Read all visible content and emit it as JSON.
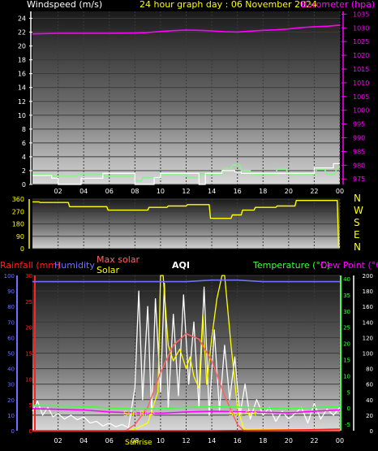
{
  "title": "24 hour graph day : 06 November 2024",
  "colors": {
    "background": "#000000",
    "wind": "#90ee90",
    "gust": "#ffffff",
    "baro": "#ff00ff",
    "dir": "#ffff00",
    "rain": "#ff2020",
    "humidity": "#7070ff",
    "max_solar": "#ff6464",
    "solar": "#ffff00",
    "aqi": "#ffffff",
    "temp": "#40ff40",
    "dew": "#ff00ff",
    "dir_letters": "#ffff00",
    "axis_white": "#ffffff"
  },
  "chart_data": [
    {
      "type": "line",
      "panel": "wind-baro",
      "left_axis_label": "Windspeed (m/s)",
      "right_axis_label": "Barometer (hpa)",
      "x_ticks": [
        "02",
        "04",
        "06",
        "08",
        "10",
        "12",
        "14",
        "16",
        "18",
        "20",
        "22",
        "00"
      ],
      "left_ticks": [
        0,
        2,
        4,
        6,
        8,
        10,
        12,
        14,
        16,
        18,
        20,
        22,
        24
      ],
      "left_range": [
        0,
        25
      ],
      "right_ticks": [
        975,
        980,
        985,
        990,
        995,
        1000,
        1005,
        1010,
        1015,
        1020,
        1025,
        1030,
        1035
      ],
      "right_range": [
        973,
        1036
      ],
      "x_range": [
        0,
        24
      ],
      "series": [
        {
          "name": "Windspeed (m/s)",
          "role": "wind",
          "x": [
            0,
            1.5,
            1.6,
            3.5,
            3.6,
            5.5,
            5.6,
            8.0,
            8.1,
            8.5,
            8.6,
            10.0,
            10.1,
            12.0,
            12.1,
            13.0,
            13.1,
            14.8,
            14.9,
            15.5,
            15.6,
            16.2,
            16.3,
            17.0,
            17.1,
            19.0,
            19.1,
            19.8,
            20.0,
            22.0,
            22.2,
            22.8,
            23.0,
            23.6,
            23.8,
            24
          ],
          "y": [
            1.5,
            1.5,
            1.2,
            1.2,
            1.5,
            1.5,
            1.2,
            1.2,
            0.5,
            0.5,
            1.0,
            1.0,
            1.5,
            1.5,
            1.0,
            1.0,
            1.5,
            1.5,
            2.3,
            2.3,
            2.8,
            2.8,
            2.0,
            2.0,
            1.5,
            1.5,
            2.2,
            2.2,
            1.5,
            1.5,
            2.2,
            2.2,
            1.5,
            1.5,
            2.5,
            2.5
          ]
        },
        {
          "name": "Gust",
          "role": "gust",
          "x": [
            0,
            1.5,
            1.5,
            2.0,
            2.0,
            3.8,
            3.8,
            5.5,
            5.5,
            8.0,
            8.0,
            9.5,
            9.5,
            10.0,
            10.0,
            13.0,
            13.0,
            13.5,
            13.5,
            14.8,
            14.8,
            15.8,
            15.8,
            16.3,
            16.3,
            22.0,
            22.0,
            23.5,
            23.5,
            24
          ],
          "y": [
            1.3,
            1.3,
            0.9,
            0.9,
            0.0,
            0.0,
            0.9,
            0.9,
            1.6,
            1.6,
            0.0,
            0.0,
            1.0,
            1.0,
            1.6,
            1.6,
            0.0,
            0.0,
            1.6,
            1.6,
            2.0,
            2.0,
            1.8,
            1.8,
            1.6,
            1.6,
            2.4,
            2.4,
            3.0,
            3.0
          ]
        },
        {
          "name": "Barometer (hpa)",
          "role": "baro",
          "x": [
            0,
            2,
            4,
            6,
            8,
            9,
            10,
            11,
            12,
            13,
            14,
            15,
            16,
            17,
            18,
            19,
            20,
            21,
            22,
            23,
            24
          ],
          "y": [
            1027.8,
            1028.0,
            1028.0,
            1028.0,
            1028.1,
            1028.3,
            1028.7,
            1029.0,
            1029.2,
            1029.1,
            1028.9,
            1028.6,
            1028.5,
            1028.8,
            1029.1,
            1029.3,
            1029.6,
            1030.1,
            1030.4,
            1030.6,
            1031.0
          ]
        }
      ]
    },
    {
      "type": "line",
      "panel": "wind-direction",
      "left_ticks": [
        0,
        90,
        180,
        270,
        360
      ],
      "left_range": [
        0,
        360
      ],
      "direction_letters": [
        "N",
        "W",
        "S",
        "E",
        "N"
      ],
      "x_range": [
        0,
        24
      ],
      "series": [
        {
          "name": "Wind direction",
          "role": "dir",
          "x": [
            0,
            0.5,
            0.6,
            2.8,
            2.9,
            5.8,
            5.9,
            9.0,
            9.1,
            10.5,
            10.6,
            12.0,
            12.1,
            13.8,
            13.9,
            15.5,
            15.6,
            16.3,
            16.4,
            17.3,
            17.4,
            19.0,
            19.1,
            20.5,
            20.6,
            23.8,
            23.9,
            24
          ],
          "y": [
            340,
            340,
            335,
            335,
            305,
            305,
            280,
            280,
            300,
            300,
            310,
            310,
            320,
            320,
            220,
            220,
            245,
            245,
            280,
            280,
            300,
            300,
            310,
            310,
            350,
            350,
            20,
            10
          ]
        }
      ]
    },
    {
      "type": "line",
      "panel": "rain-humidity-solar-temp",
      "header_labels": [
        "Rainfall (mm)",
        "Humidity",
        "Max solar",
        "Solar",
        "AQI",
        "Temperature (°C)",
        "Dew Point (°C)"
      ],
      "annotations": [
        "Sun Rise",
        "Sun Set",
        "Sunrise"
      ],
      "x_ticks": [
        "02",
        "04",
        "06",
        "08",
        "10",
        "12",
        "14",
        "16",
        "18",
        "20",
        "22",
        "00"
      ],
      "humidity_ticks": [
        0,
        10,
        20,
        30,
        40,
        50,
        60,
        70,
        80,
        90,
        100
      ],
      "humidity_range": [
        0,
        100
      ],
      "rain_ticks": [
        0,
        5,
        10,
        15,
        20,
        25,
        30
      ],
      "rain_range": [
        0,
        30
      ],
      "temp_ticks": [
        -5,
        0,
        5,
        10,
        15,
        20,
        25,
        30,
        35,
        40
      ],
      "temp_range": [
        -7,
        41
      ],
      "solar_ticks": [
        0,
        20,
        40,
        60,
        80,
        100,
        120,
        140,
        160,
        180,
        200
      ],
      "solar_range": [
        0,
        200
      ],
      "x_range": [
        0,
        24
      ],
      "series": [
        {
          "name": "Humidity",
          "role": "humidity",
          "x": [
            0,
            4,
            8,
            12,
            14,
            16,
            18,
            20,
            22,
            24
          ],
          "y": [
            96,
            96,
            96,
            96,
            97,
            97,
            96,
            96,
            96,
            96
          ]
        },
        {
          "name": "Temperature (°C)",
          "role": "temp",
          "x": [
            0,
            2,
            4,
            6,
            8,
            10,
            12,
            14,
            16,
            18,
            20,
            22,
            24
          ],
          "y": [
            0.8,
            0.7,
            0.5,
            0.0,
            -0.3,
            -0.2,
            0.2,
            0.5,
            0.3,
            0.0,
            -0.2,
            0.2,
            0.5
          ]
        },
        {
          "name": "Dew Point (°C)",
          "role": "dew",
          "x": [
            0,
            2,
            4,
            6,
            8,
            10,
            12,
            14,
            16,
            18,
            20,
            22,
            24
          ],
          "y": [
            -0.2,
            -0.4,
            -0.6,
            -1.2,
            -1.5,
            -1.6,
            -1.2,
            -1.0,
            -1.1,
            -1.3,
            -1.5,
            -1.0,
            -0.6
          ]
        },
        {
          "name": "Rainfall (mm)",
          "role": "rain",
          "x": [
            0,
            14,
            18,
            22,
            24
          ],
          "y": [
            0,
            0,
            0.1,
            0.2,
            0.3
          ]
        },
        {
          "name": "Max solar",
          "role": "max_solar",
          "x": [
            0,
            7.3,
            8,
            9,
            10,
            11,
            12,
            13,
            14,
            15,
            16,
            16.5,
            24
          ],
          "y": [
            0,
            0,
            8,
            30,
            75,
            110,
            125,
            118,
            90,
            45,
            8,
            0,
            0
          ]
        },
        {
          "name": "Solar",
          "role": "solar",
          "x": [
            0,
            7.5,
            8,
            9,
            9.8,
            10.0,
            10.2,
            10.6,
            11,
            11.5,
            12,
            12.3,
            12.6,
            13,
            13.3,
            13.6,
            14,
            14.4,
            14.8,
            15.0,
            15.2,
            15.5,
            16,
            16.5,
            24
          ],
          "y": [
            0,
            0,
            2,
            10,
            50,
            200,
            200,
            110,
            90,
            105,
            80,
            95,
            70,
            55,
            150,
            60,
            120,
            170,
            200,
            200,
            165,
            110,
            30,
            2,
            2
          ]
        },
        {
          "name": "AQI",
          "role": "aqi",
          "x": [
            0,
            0.4,
            0.8,
            1.2,
            1.6,
            2,
            2.5,
            3,
            3.5,
            4,
            4.5,
            5,
            5.5,
            6,
            6.5,
            7,
            7.5,
            8,
            8.3,
            8.6,
            9,
            9.3,
            9.6,
            10,
            10.3,
            10.6,
            11,
            11.4,
            11.8,
            12.2,
            12.6,
            13,
            13.4,
            13.8,
            14.2,
            14.6,
            15,
            15.4,
            15.8,
            16.2,
            16.6,
            17,
            17.5,
            18,
            18.5,
            19,
            19.5,
            20,
            20.5,
            21,
            21.5,
            22,
            22.5,
            23,
            23.5,
            24
          ],
          "y": [
            25,
            38,
            20,
            30,
            18,
            22,
            15,
            20,
            14,
            18,
            10,
            12,
            6,
            10,
            5,
            8,
            4,
            55,
            180,
            40,
            160,
            20,
            170,
            50,
            190,
            30,
            150,
            45,
            175,
            60,
            140,
            30,
            185,
            20,
            130,
            25,
            110,
            40,
            95,
            20,
            60,
            15,
            40,
            20,
            30,
            12,
            25,
            15,
            22,
            30,
            10,
            35,
            15,
            28,
            20,
            30
          ]
        }
      ]
    }
  ]
}
